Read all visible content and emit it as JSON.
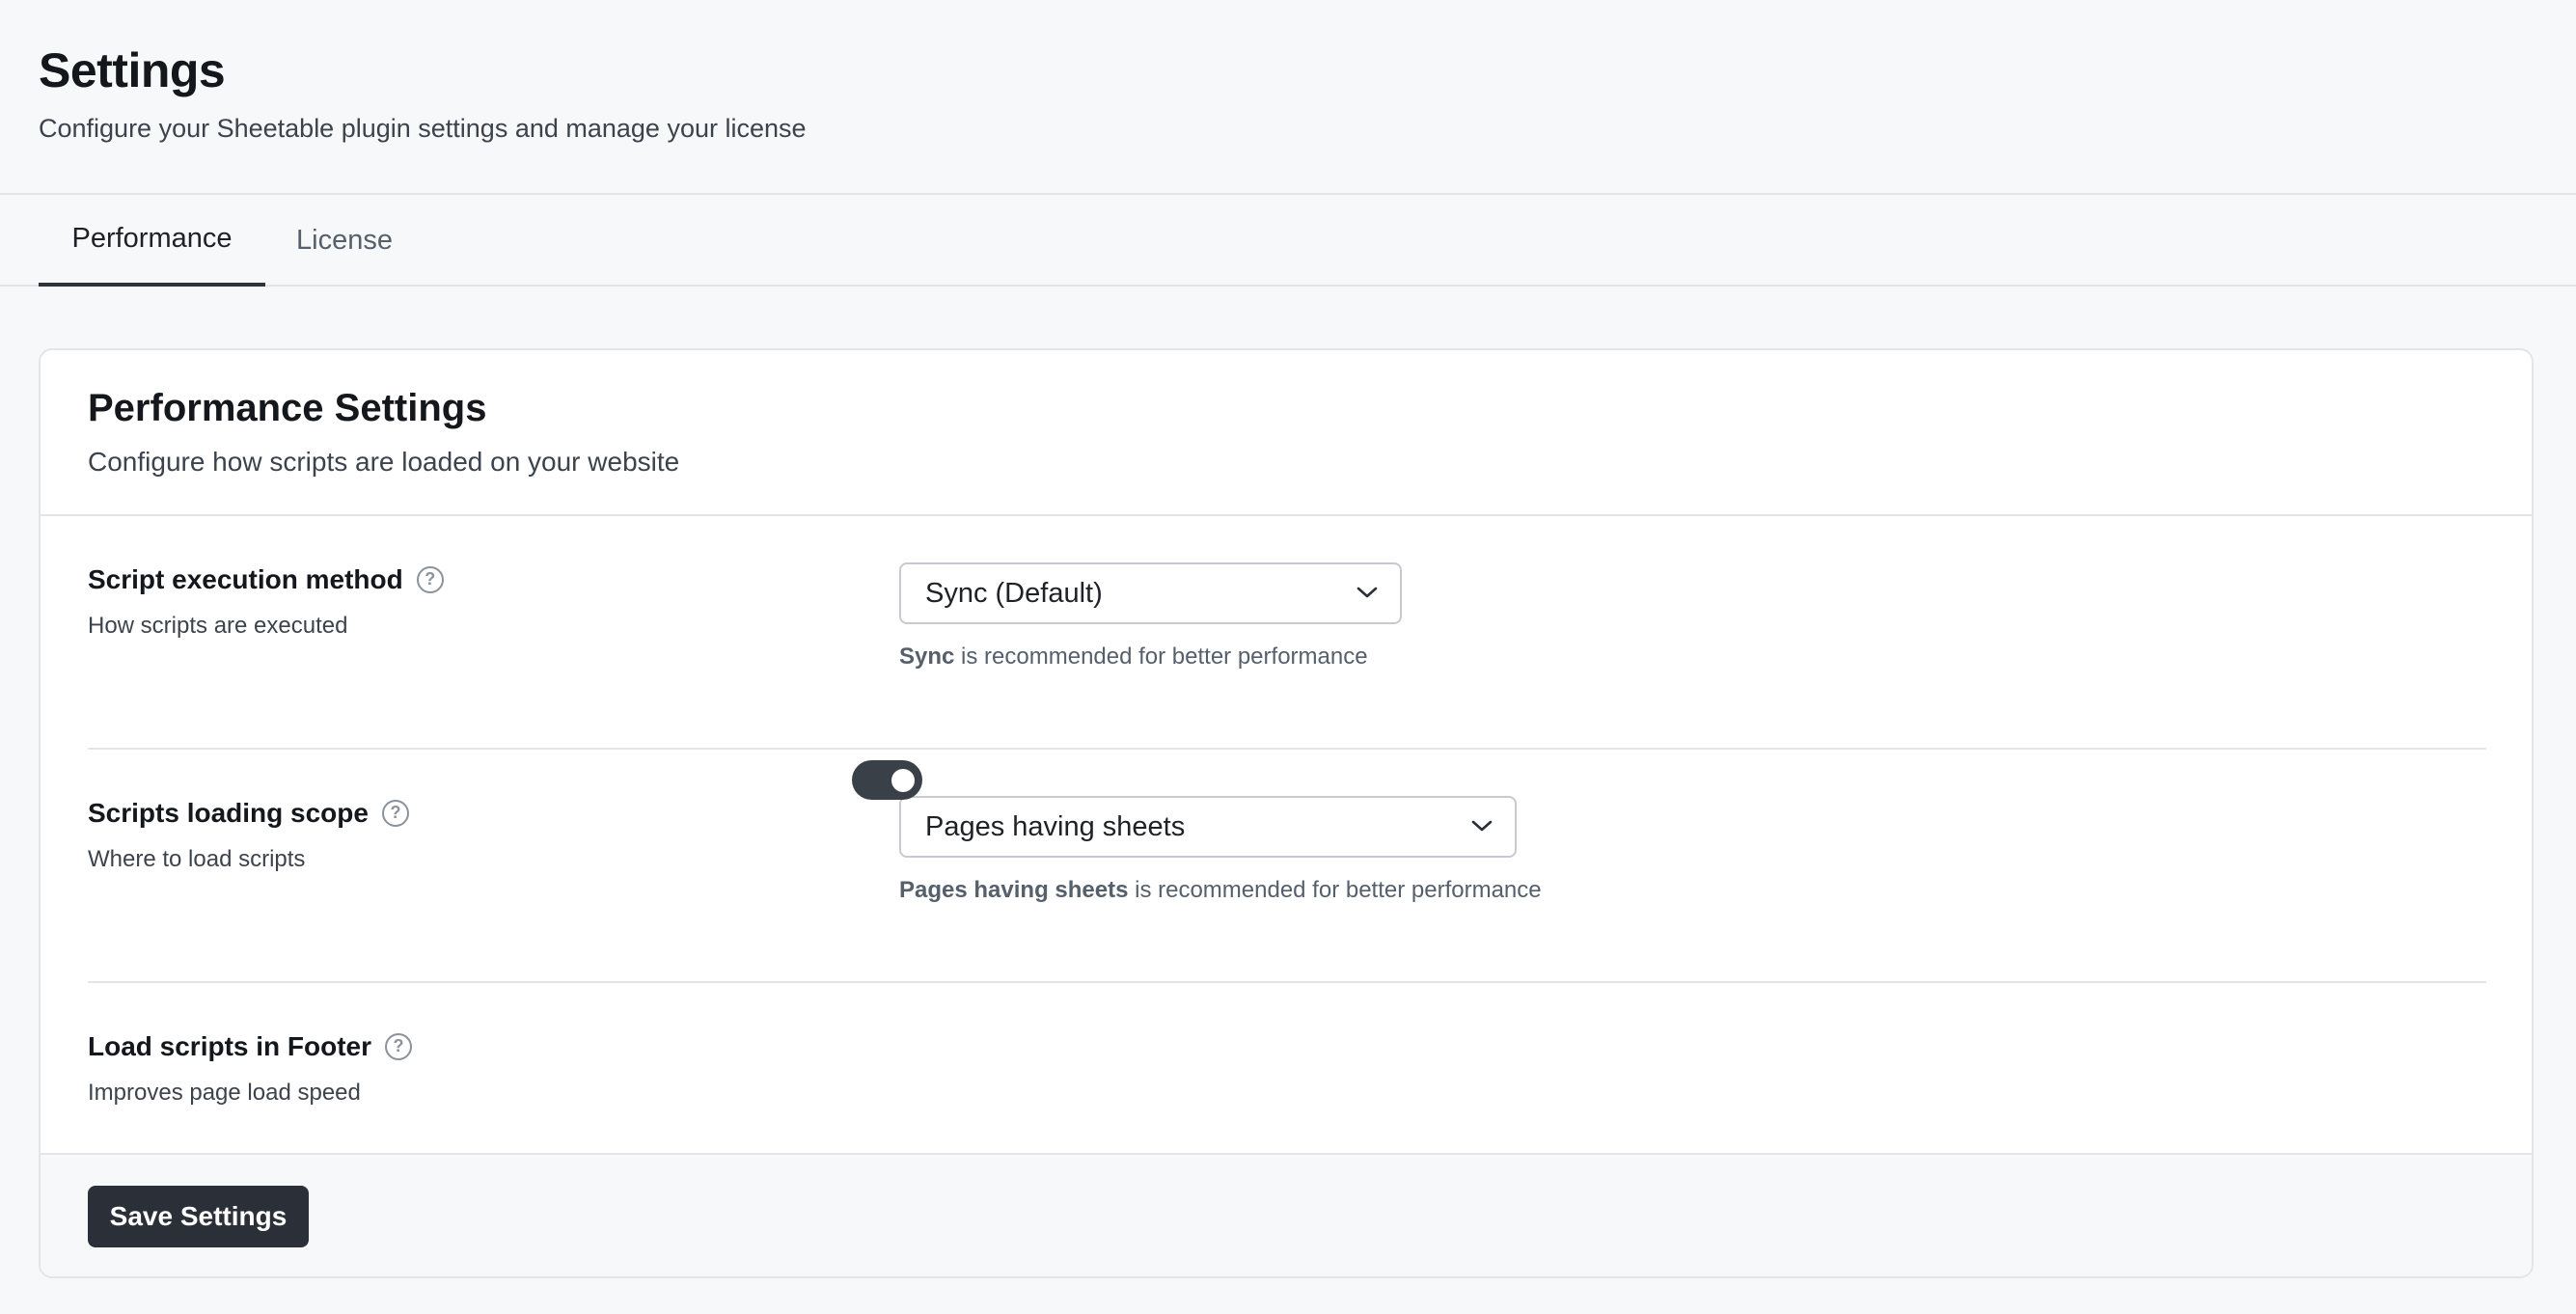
{
  "header": {
    "title": "Settings",
    "subtitle": "Configure your Sheetable plugin settings and manage your license"
  },
  "tabs": [
    {
      "label": "Performance",
      "active": true
    },
    {
      "label": "License",
      "active": false
    }
  ],
  "card": {
    "title": "Performance Settings",
    "subtitle": "Configure how scripts are loaded on your website"
  },
  "settings": [
    {
      "label": "Script execution method",
      "description": "How scripts are executed",
      "control": "select",
      "value": "Sync (Default)",
      "hint_strong": "Sync",
      "hint_rest": " is recommended for better performance",
      "icon": "help-circle-icon"
    },
    {
      "label": "Scripts loading scope",
      "description": "Where to load scripts",
      "control": "select",
      "value": "Pages having sheets",
      "hint_strong": "Pages having sheets",
      "hint_rest": " is recommended for better performance",
      "icon": "help-circle-icon"
    },
    {
      "label": "Load scripts in Footer",
      "description": "Improves page load speed",
      "control": "toggle",
      "enabled": true,
      "icon": "help-circle-icon"
    }
  ],
  "footer": {
    "save_label": "Save Settings"
  },
  "colors": {
    "background": "#f7f8fa",
    "card": "#ffffff",
    "primary_button": "#2b3038",
    "toggle_on": "#3a4048",
    "border": "#e3e5e8"
  }
}
